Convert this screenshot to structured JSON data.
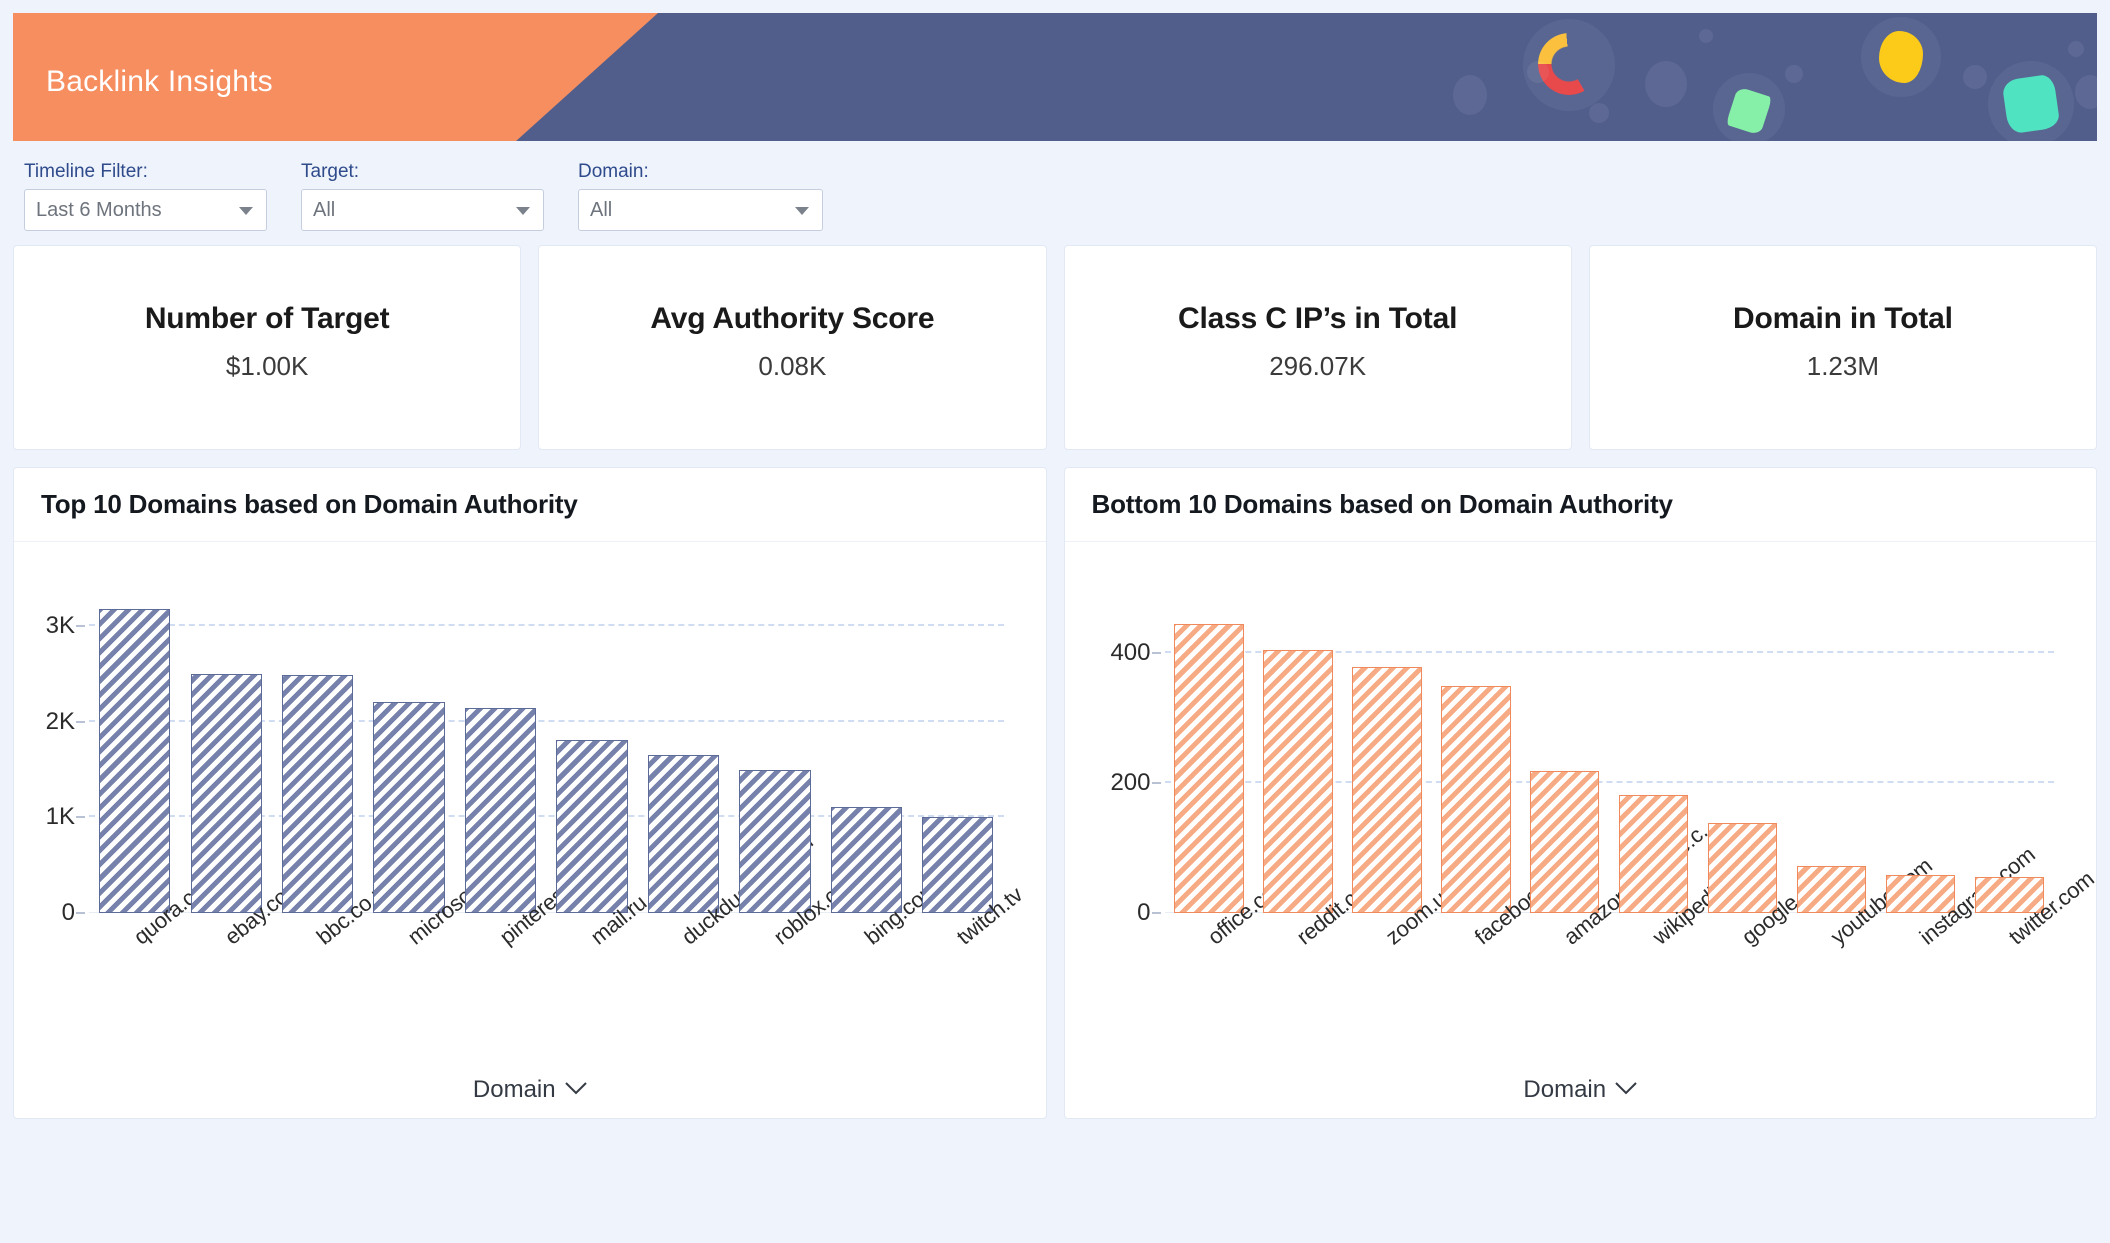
{
  "header": {
    "title": "Backlink Insights",
    "banner_color": "#f68e5f",
    "background_color": "#515e8c"
  },
  "filters": [
    {
      "label": "Timeline Filter:",
      "value": "Last 6 Months",
      "icon": "chevron-down-icon"
    },
    {
      "label": "Target:",
      "value": "All",
      "icon": "chevron-down-icon"
    },
    {
      "label": "Domain:",
      "value": "All",
      "icon": "chevron-down-icon"
    }
  ],
  "kpis": [
    {
      "title": "Number of Target",
      "value": "$1.00K"
    },
    {
      "title": "Avg Authority Score",
      "value": "0.08K"
    },
    {
      "title": "Class C IP’s in Total",
      "value": "296.07K"
    },
    {
      "title": "Domain in Total",
      "value": "1.23M"
    }
  ],
  "charts": [
    {
      "title": "Top 10 Domains based on Domain Authority",
      "axis_title": "Domain"
    },
    {
      "title": "Bottom 10 Domains based on Domain Authority",
      "axis_title": "Domain"
    }
  ],
  "chart_data": [
    {
      "type": "bar",
      "title": "Top 10 Domains based on Domain Authority",
      "xlabel": "Domain",
      "ylabel": "",
      "categories": [
        "quora.com",
        "ebay.com",
        "bbc.co.uk",
        "microsoft.com",
        "pinterest.com",
        "mail.ru",
        "duckduckgo.com",
        "roblox.com",
        "bing.com",
        "twitch.tv"
      ],
      "values": [
        3180,
        2500,
        2490,
        2210,
        2140,
        1810,
        1650,
        1500,
        1110,
        1000
      ],
      "tick_labels": [
        "0",
        "1K",
        "2K",
        "3K"
      ],
      "tick_values": [
        0,
        1000,
        2000,
        3000
      ],
      "ylim": [
        0,
        3400
      ],
      "grid": true,
      "bar_color": "#7682ab",
      "bar_border_color": "#5d6b99",
      "legend": "none"
    },
    {
      "type": "bar",
      "title": "Bottom 10 Domains based on Domain Authority",
      "xlabel": "Domain",
      "ylabel": "",
      "categories": [
        "office.com",
        "reddit.com",
        "zoom.us",
        "facebook.com",
        "amazon.comlive.c..",
        "wikipedia.org",
        "google.com",
        "youtube.com",
        "instagram.com",
        "twitter.com"
      ],
      "values": [
        445,
        405,
        378,
        350,
        218,
        182,
        138,
        72,
        58,
        55
      ],
      "tick_labels": [
        "0",
        "200",
        "400"
      ],
      "tick_values": [
        0,
        200,
        400
      ],
      "ylim": [
        0,
        500
      ],
      "grid": true,
      "bar_color": "#f7ab84",
      "bar_border_color": "#f08a5c",
      "legend": "none"
    }
  ]
}
